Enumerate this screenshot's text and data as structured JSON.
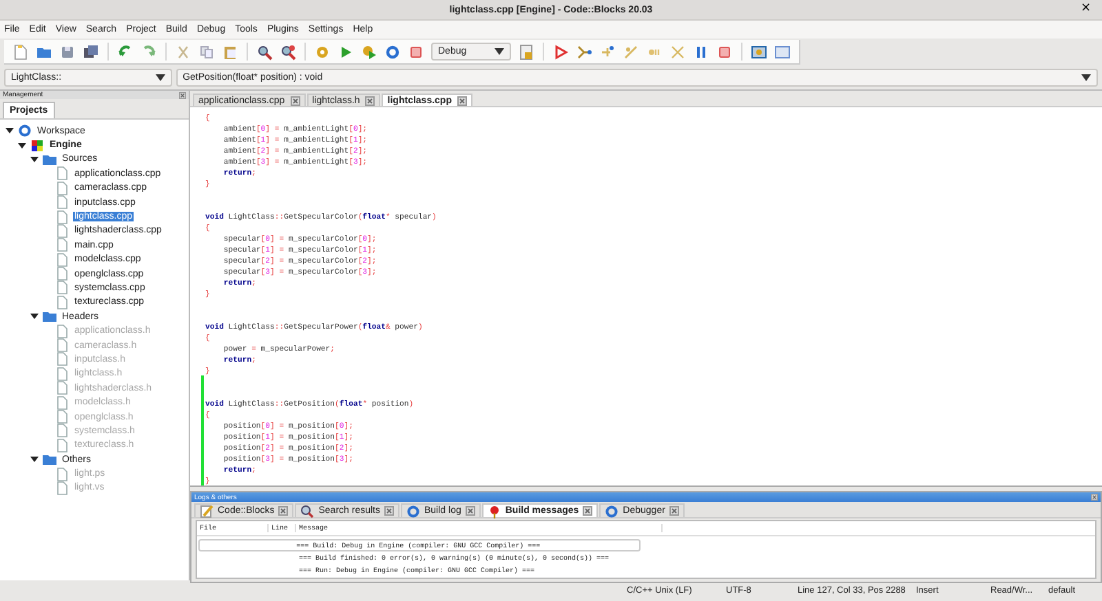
{
  "window": {
    "title": "lightclass.cpp [Engine] - Code::Blocks 20.03",
    "close": "×"
  },
  "menu": [
    "File",
    "Edit",
    "View",
    "Search",
    "Project",
    "Build",
    "Debug",
    "Tools",
    "Plugins",
    "Settings",
    "Help"
  ],
  "toolbar": {
    "build_target": "Debug"
  },
  "code_bar": {
    "scope": "LightClass::",
    "function": "GetPosition(float* position) : void"
  },
  "management": {
    "title": "Management",
    "tabs": [
      {
        "label": "Projects",
        "selected": true
      }
    ],
    "tree": [
      {
        "label": "Workspace",
        "kind": "workspace",
        "expanded": true,
        "selected": false,
        "children": [
          {
            "label": "Engine",
            "kind": "project",
            "expanded": true,
            "selected": false,
            "children": [
              {
                "label": "Sources",
                "kind": "folder",
                "expanded": true,
                "selected": false,
                "children": [
                  {
                    "label": "applicationclass.cpp",
                    "kind": "file",
                    "selected": false,
                    "dimmed": false
                  },
                  {
                    "label": "cameraclass.cpp",
                    "kind": "file",
                    "selected": false,
                    "dimmed": false
                  },
                  {
                    "label": "inputclass.cpp",
                    "kind": "file",
                    "selected": false,
                    "dimmed": false
                  },
                  {
                    "label": "lightclass.cpp",
                    "kind": "file",
                    "selected": true,
                    "dimmed": false
                  },
                  {
                    "label": "lightshaderclass.cpp",
                    "kind": "file",
                    "selected": false,
                    "dimmed": false
                  },
                  {
                    "label": "main.cpp",
                    "kind": "file",
                    "selected": false,
                    "dimmed": false
                  },
                  {
                    "label": "modelclass.cpp",
                    "kind": "file",
                    "selected": false,
                    "dimmed": false
                  },
                  {
                    "label": "openglclass.cpp",
                    "kind": "file",
                    "selected": false,
                    "dimmed": false
                  },
                  {
                    "label": "systemclass.cpp",
                    "kind": "file",
                    "selected": false,
                    "dimmed": false
                  },
                  {
                    "label": "textureclass.cpp",
                    "kind": "file",
                    "selected": false,
                    "dimmed": false
                  }
                ]
              },
              {
                "label": "Headers",
                "kind": "folder",
                "expanded": true,
                "selected": false,
                "children": [
                  {
                    "label": "applicationclass.h",
                    "kind": "file",
                    "selected": false,
                    "dimmed": true
                  },
                  {
                    "label": "cameraclass.h",
                    "kind": "file",
                    "selected": false,
                    "dimmed": true
                  },
                  {
                    "label": "inputclass.h",
                    "kind": "file",
                    "selected": false,
                    "dimmed": true
                  },
                  {
                    "label": "lightclass.h",
                    "kind": "file",
                    "selected": false,
                    "dimmed": true
                  },
                  {
                    "label": "lightshaderclass.h",
                    "kind": "file",
                    "selected": false,
                    "dimmed": true
                  },
                  {
                    "label": "modelclass.h",
                    "kind": "file",
                    "selected": false,
                    "dimmed": true
                  },
                  {
                    "label": "openglclass.h",
                    "kind": "file",
                    "selected": false,
                    "dimmed": true
                  },
                  {
                    "label": "systemclass.h",
                    "kind": "file",
                    "selected": false,
                    "dimmed": true
                  },
                  {
                    "label": "textureclass.h",
                    "kind": "file",
                    "selected": false,
                    "dimmed": true
                  }
                ]
              },
              {
                "label": "Others",
                "kind": "folder",
                "expanded": true,
                "selected": false,
                "children": [
                  {
                    "label": "light.ps",
                    "kind": "file",
                    "selected": false,
                    "dimmed": true
                  },
                  {
                    "label": "light.vs",
                    "kind": "file",
                    "selected": false,
                    "dimmed": true
                  }
                ]
              }
            ]
          }
        ]
      }
    ]
  },
  "editor": {
    "tabs": [
      {
        "label": "applicationclass.cpp",
        "selected": false
      },
      {
        "label": "lightclass.h",
        "selected": false
      },
      {
        "label": "lightclass.cpp",
        "selected": true
      }
    ],
    "lines": [
      {
        "modified": false,
        "tokens": [
          {
            "kind": "op",
            "text": "{"
          }
        ]
      },
      {
        "modified": false,
        "tokens": [
          {
            "kind": "plain",
            "text": "    ambient"
          },
          {
            "kind": "op",
            "text": "["
          },
          {
            "kind": "num",
            "text": "0"
          },
          {
            "kind": "op",
            "text": "] ="
          },
          {
            "kind": "plain",
            "text": " m_ambientLight"
          },
          {
            "kind": "op",
            "text": "["
          },
          {
            "kind": "num",
            "text": "0"
          },
          {
            "kind": "op",
            "text": "];"
          }
        ]
      },
      {
        "modified": false,
        "tokens": [
          {
            "kind": "plain",
            "text": "    ambient"
          },
          {
            "kind": "op",
            "text": "["
          },
          {
            "kind": "num",
            "text": "1"
          },
          {
            "kind": "op",
            "text": "] ="
          },
          {
            "kind": "plain",
            "text": " m_ambientLight"
          },
          {
            "kind": "op",
            "text": "["
          },
          {
            "kind": "num",
            "text": "1"
          },
          {
            "kind": "op",
            "text": "];"
          }
        ]
      },
      {
        "modified": false,
        "tokens": [
          {
            "kind": "plain",
            "text": "    ambient"
          },
          {
            "kind": "op",
            "text": "["
          },
          {
            "kind": "num",
            "text": "2"
          },
          {
            "kind": "op",
            "text": "] ="
          },
          {
            "kind": "plain",
            "text": " m_ambientLight"
          },
          {
            "kind": "op",
            "text": "["
          },
          {
            "kind": "num",
            "text": "2"
          },
          {
            "kind": "op",
            "text": "];"
          }
        ]
      },
      {
        "modified": false,
        "tokens": [
          {
            "kind": "plain",
            "text": "    ambient"
          },
          {
            "kind": "op",
            "text": "["
          },
          {
            "kind": "num",
            "text": "3"
          },
          {
            "kind": "op",
            "text": "] ="
          },
          {
            "kind": "plain",
            "text": " m_ambientLight"
          },
          {
            "kind": "op",
            "text": "["
          },
          {
            "kind": "num",
            "text": "3"
          },
          {
            "kind": "op",
            "text": "];"
          }
        ]
      },
      {
        "modified": false,
        "tokens": [
          {
            "kind": "keyword",
            "text": "    return"
          },
          {
            "kind": "op",
            "text": ";"
          }
        ]
      },
      {
        "modified": false,
        "tokens": [
          {
            "kind": "op",
            "text": "}"
          }
        ]
      },
      {
        "modified": false
      },
      {
        "modified": false
      },
      {
        "modified": false,
        "tokens": [
          {
            "kind": "keyword",
            "text": "void"
          },
          {
            "kind": "plain",
            "text": " LightClass"
          },
          {
            "kind": "op",
            "text": "::"
          },
          {
            "kind": "plain",
            "text": "GetSpecularColor"
          },
          {
            "kind": "op",
            "text": "("
          },
          {
            "kind": "keyword",
            "text": "float"
          },
          {
            "kind": "op",
            "text": "*"
          },
          {
            "kind": "plain",
            "text": " specular"
          },
          {
            "kind": "op",
            "text": ")"
          }
        ]
      },
      {
        "modified": false,
        "tokens": [
          {
            "kind": "op",
            "text": "{"
          }
        ]
      },
      {
        "modified": false,
        "tokens": [
          {
            "kind": "plain",
            "text": "    specular"
          },
          {
            "kind": "op",
            "text": "["
          },
          {
            "kind": "num",
            "text": "0"
          },
          {
            "kind": "op",
            "text": "] ="
          },
          {
            "kind": "plain",
            "text": " m_specularColor"
          },
          {
            "kind": "op",
            "text": "["
          },
          {
            "kind": "num",
            "text": "0"
          },
          {
            "kind": "op",
            "text": "];"
          }
        ]
      },
      {
        "modified": false,
        "tokens": [
          {
            "kind": "plain",
            "text": "    specular"
          },
          {
            "kind": "op",
            "text": "["
          },
          {
            "kind": "num",
            "text": "1"
          },
          {
            "kind": "op",
            "text": "] ="
          },
          {
            "kind": "plain",
            "text": " m_specularColor"
          },
          {
            "kind": "op",
            "text": "["
          },
          {
            "kind": "num",
            "text": "1"
          },
          {
            "kind": "op",
            "text": "];"
          }
        ]
      },
      {
        "modified": false,
        "tokens": [
          {
            "kind": "plain",
            "text": "    specular"
          },
          {
            "kind": "op",
            "text": "["
          },
          {
            "kind": "num",
            "text": "2"
          },
          {
            "kind": "op",
            "text": "] ="
          },
          {
            "kind": "plain",
            "text": " m_specularColor"
          },
          {
            "kind": "op",
            "text": "["
          },
          {
            "kind": "num",
            "text": "2"
          },
          {
            "kind": "op",
            "text": "];"
          }
        ]
      },
      {
        "modified": false,
        "tokens": [
          {
            "kind": "plain",
            "text": "    specular"
          },
          {
            "kind": "op",
            "text": "["
          },
          {
            "kind": "num",
            "text": "3"
          },
          {
            "kind": "op",
            "text": "] ="
          },
          {
            "kind": "plain",
            "text": " m_specularColor"
          },
          {
            "kind": "op",
            "text": "["
          },
          {
            "kind": "num",
            "text": "3"
          },
          {
            "kind": "op",
            "text": "];"
          }
        ]
      },
      {
        "modified": false,
        "tokens": [
          {
            "kind": "keyword",
            "text": "    return"
          },
          {
            "kind": "op",
            "text": ";"
          }
        ]
      },
      {
        "modified": false,
        "tokens": [
          {
            "kind": "op",
            "text": "}"
          }
        ]
      },
      {
        "modified": false
      },
      {
        "modified": false
      },
      {
        "modified": false,
        "tokens": [
          {
            "kind": "keyword",
            "text": "void"
          },
          {
            "kind": "plain",
            "text": " LightClass"
          },
          {
            "kind": "op",
            "text": "::"
          },
          {
            "kind": "plain",
            "text": "GetSpecularPower"
          },
          {
            "kind": "op",
            "text": "("
          },
          {
            "kind": "keyword",
            "text": "float"
          },
          {
            "kind": "op",
            "text": "&"
          },
          {
            "kind": "plain",
            "text": " power"
          },
          {
            "kind": "op",
            "text": ")"
          }
        ]
      },
      {
        "modified": false,
        "tokens": [
          {
            "kind": "op",
            "text": "{"
          }
        ]
      },
      {
        "modified": false,
        "tokens": [
          {
            "kind": "plain",
            "text": "    power "
          },
          {
            "kind": "op",
            "text": "="
          },
          {
            "kind": "plain",
            "text": " m_specularPower"
          },
          {
            "kind": "op",
            "text": ";"
          }
        ]
      },
      {
        "modified": false,
        "tokens": [
          {
            "kind": "keyword",
            "text": "    return"
          },
          {
            "kind": "op",
            "text": ";"
          }
        ]
      },
      {
        "modified": false,
        "tokens": [
          {
            "kind": "op",
            "text": "}"
          }
        ]
      },
      {
        "modified": true
      },
      {
        "modified": true
      },
      {
        "modified": true,
        "tokens": [
          {
            "kind": "keyword",
            "text": "void"
          },
          {
            "kind": "plain",
            "text": " LightClass"
          },
          {
            "kind": "op",
            "text": "::"
          },
          {
            "kind": "plain",
            "text": "GetPosition"
          },
          {
            "kind": "op",
            "text": "("
          },
          {
            "kind": "keyword",
            "text": "float"
          },
          {
            "kind": "op",
            "text": "*"
          },
          {
            "kind": "plain",
            "text": " position"
          },
          {
            "kind": "op",
            "text": ")"
          }
        ]
      },
      {
        "modified": true,
        "tokens": [
          {
            "kind": "op",
            "text": "{"
          }
        ]
      },
      {
        "modified": true,
        "tokens": [
          {
            "kind": "plain",
            "text": "    position"
          },
          {
            "kind": "op",
            "text": "["
          },
          {
            "kind": "num",
            "text": "0"
          },
          {
            "kind": "op",
            "text": "] ="
          },
          {
            "kind": "plain",
            "text": " m_position"
          },
          {
            "kind": "op",
            "text": "["
          },
          {
            "kind": "num",
            "text": "0"
          },
          {
            "kind": "op",
            "text": "];"
          }
        ]
      },
      {
        "modified": true,
        "tokens": [
          {
            "kind": "plain",
            "text": "    position"
          },
          {
            "kind": "op",
            "text": "["
          },
          {
            "kind": "num",
            "text": "1"
          },
          {
            "kind": "op",
            "text": "] ="
          },
          {
            "kind": "plain",
            "text": " m_position"
          },
          {
            "kind": "op",
            "text": "["
          },
          {
            "kind": "num",
            "text": "1"
          },
          {
            "kind": "op",
            "text": "];"
          }
        ]
      },
      {
        "modified": true,
        "tokens": [
          {
            "kind": "plain",
            "text": "    position"
          },
          {
            "kind": "op",
            "text": "["
          },
          {
            "kind": "num",
            "text": "2"
          },
          {
            "kind": "op",
            "text": "] ="
          },
          {
            "kind": "plain",
            "text": " m_position"
          },
          {
            "kind": "op",
            "text": "["
          },
          {
            "kind": "num",
            "text": "2"
          },
          {
            "kind": "op",
            "text": "];"
          }
        ]
      },
      {
        "modified": true,
        "tokens": [
          {
            "kind": "plain",
            "text": "    position"
          },
          {
            "kind": "op",
            "text": "["
          },
          {
            "kind": "num",
            "text": "3"
          },
          {
            "kind": "op",
            "text": "] ="
          },
          {
            "kind": "plain",
            "text": " m_position"
          },
          {
            "kind": "op",
            "text": "["
          },
          {
            "kind": "num",
            "text": "3"
          },
          {
            "kind": "op",
            "text": "];"
          }
        ]
      },
      {
        "modified": true,
        "tokens": [
          {
            "kind": "keyword",
            "text": "    return"
          },
          {
            "kind": "op",
            "text": ";"
          }
        ]
      },
      {
        "modified": true,
        "tokens": [
          {
            "kind": "op",
            "text": "}"
          }
        ]
      }
    ]
  },
  "logs": {
    "title": "Logs & others",
    "tabs": [
      {
        "label": "Code::Blocks",
        "selected": false
      },
      {
        "label": "Search results",
        "selected": false
      },
      {
        "label": "Build log",
        "selected": false
      },
      {
        "label": "Build messages",
        "selected": true
      },
      {
        "label": "Debugger",
        "selected": false
      }
    ],
    "columns": [
      "File",
      "Line",
      "Message"
    ],
    "rows": [
      {
        "message": "=== Build: Debug in Engine (compiler: GNU GCC Compiler) ===",
        "selected": true
      },
      {
        "message": "=== Build finished: 0 error(s), 0 warning(s) (0 minute(s), 0 second(s)) ===",
        "selected": false
      },
      {
        "message": "=== Run: Debug in Engine (compiler: GNU GCC Compiler) ===",
        "selected": false
      }
    ]
  },
  "status_bar": [
    "C/C++ Unix (LF)",
    "UTF-8",
    "Line 127, Col 33, Pos 2288",
    "Insert",
    "Read/Wr...",
    "default"
  ]
}
